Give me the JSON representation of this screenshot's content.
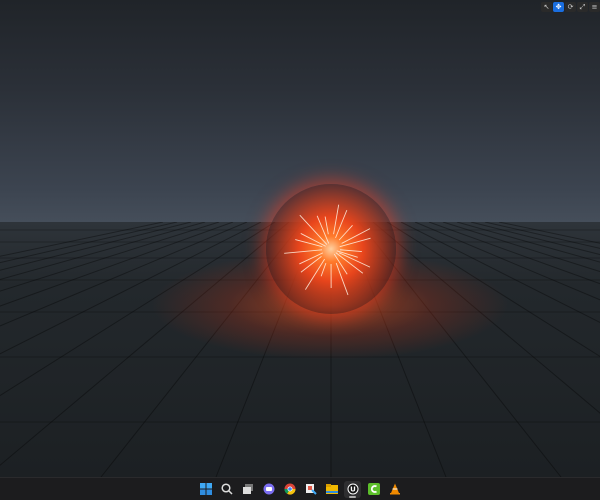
{
  "viewport_toolbar": {
    "buttons": [
      {
        "icon": "select-icon"
      },
      {
        "icon": "translate-icon",
        "active": true
      },
      {
        "icon": "rotate-icon"
      },
      {
        "icon": "scale-icon"
      }
    ]
  },
  "taskbar": {
    "icons": [
      {
        "name": "windows-start-icon"
      },
      {
        "name": "search-icon"
      },
      {
        "name": "task-view-icon"
      },
      {
        "name": "chat-icon"
      },
      {
        "name": "chrome-icon"
      },
      {
        "name": "paint-icon"
      },
      {
        "name": "file-explorer-icon"
      },
      {
        "name": "unreal-engine-icon",
        "active": true
      },
      {
        "name": "camtasia-icon"
      },
      {
        "name": "vlc-icon"
      }
    ]
  },
  "colors": {
    "accent": "#1a6ee0",
    "orb": "#ff5a22"
  }
}
